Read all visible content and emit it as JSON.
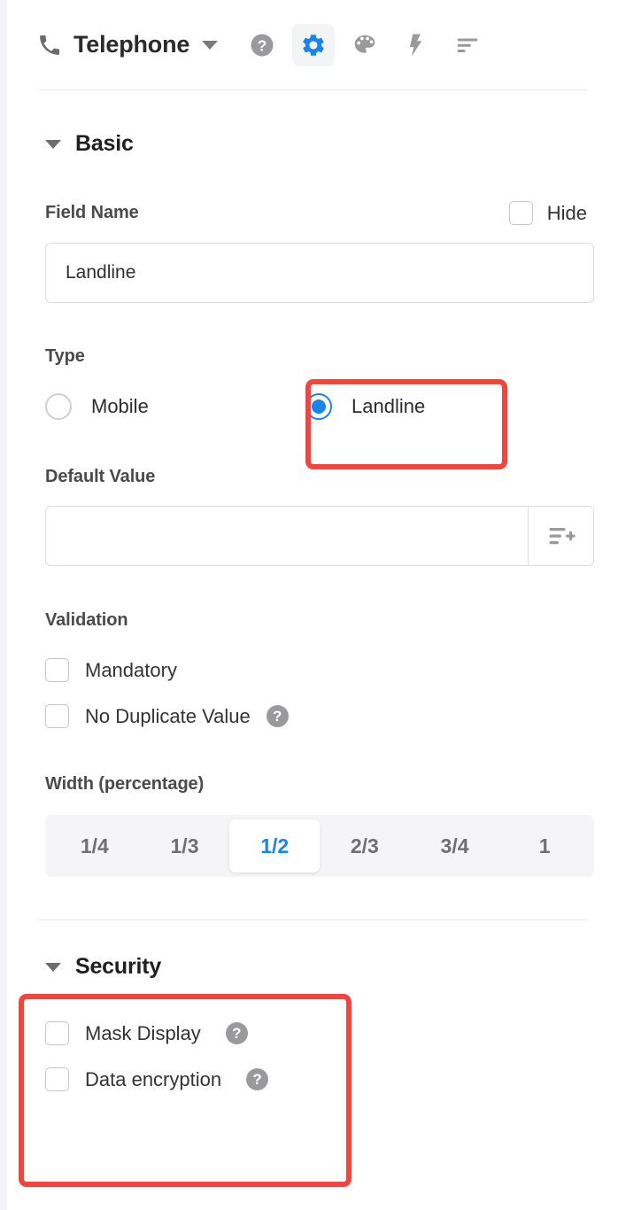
{
  "header": {
    "phone_icon": "phone-icon",
    "title": "Telephone",
    "caret_icon": "chevron-down-icon",
    "icons": [
      {
        "name": "help-icon",
        "glyph": "?",
        "active": false
      },
      {
        "name": "gear-icon",
        "glyph": "",
        "active": true
      },
      {
        "name": "palette-icon",
        "glyph": "",
        "active": false
      },
      {
        "name": "lightning-icon",
        "glyph": "",
        "active": false
      },
      {
        "name": "sort-icon",
        "glyph": "",
        "active": false
      }
    ]
  },
  "basic": {
    "section_title": "Basic",
    "field_name_label": "Field Name",
    "hide_label": "Hide",
    "hide_checked": false,
    "field_name_value": "Landline",
    "field_name_placeholder": "",
    "type_label": "Type",
    "type_options": [
      {
        "label": "Mobile",
        "selected": false
      },
      {
        "label": "Landline",
        "selected": true
      }
    ],
    "default_value_label": "Default Value",
    "default_value": "",
    "default_value_placeholder": "",
    "default_value_button_icon": "insert-list-plus-icon",
    "validation_label": "Validation",
    "validation_options": [
      {
        "label": "Mandatory",
        "checked": false,
        "help": false
      },
      {
        "label": "No Duplicate Value",
        "checked": false,
        "help": true
      }
    ],
    "width_label": "Width (percentage)",
    "width_options": [
      {
        "label": "1/4",
        "selected": false
      },
      {
        "label": "1/3",
        "selected": false
      },
      {
        "label": "1/2",
        "selected": true
      },
      {
        "label": "2/3",
        "selected": false
      },
      {
        "label": "3/4",
        "selected": false
      },
      {
        "label": "1",
        "selected": false
      }
    ]
  },
  "security": {
    "section_title": "Security",
    "options": [
      {
        "label": "Mask Display",
        "checked": false,
        "help": true
      },
      {
        "label": "Data encryption",
        "checked": false,
        "help": true
      }
    ]
  },
  "help_glyph": "?",
  "colors": {
    "accent_blue": "#1a85e8",
    "highlight_red": "#f4453c",
    "text_dark": "#2b2b2b",
    "label_gray": "#4a4a4a",
    "icon_gray": "#9a9a9c",
    "divider": "#e9e9ed",
    "segmented_bg": "#f5f5f7"
  },
  "highlights": [
    {
      "name": "landline-option-highlight",
      "target": "type-option-landline"
    },
    {
      "name": "security-section-highlight",
      "target": "security-section"
    }
  ]
}
